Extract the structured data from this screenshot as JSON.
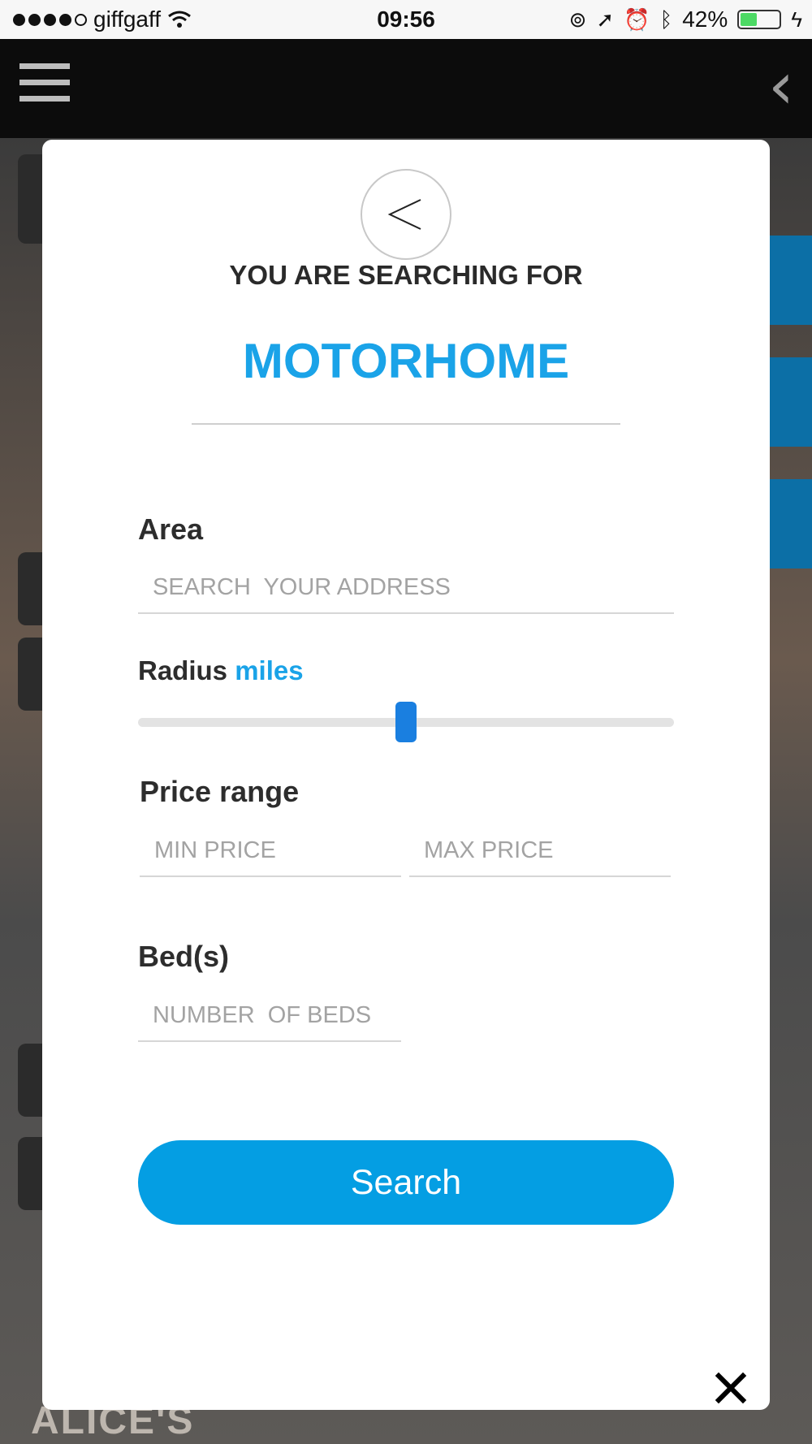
{
  "status_bar": {
    "carrier": "giffgaff",
    "time": "09:56",
    "battery": "42%",
    "battery_level": 0.42
  },
  "background": {
    "bottom_text": "ALICE'S"
  },
  "modal": {
    "heading": "YOU ARE SEARCHING FOR",
    "category": "MOTORHOME",
    "area": {
      "label": "Area",
      "placeholder": "SEARCH  YOUR ADDRESS"
    },
    "radius": {
      "label": "Radius",
      "unit": "miles",
      "value_fraction": 0.5
    },
    "price_range": {
      "label": "Price range",
      "min_placeholder": "MIN PRICE",
      "max_placeholder": "MAX PRICE"
    },
    "beds": {
      "label": "Bed(s)",
      "placeholder": "NUMBER  OF BEDS"
    },
    "search_button": "Search"
  },
  "colors": {
    "accent": "#1aa3e8",
    "button": "#049ee3",
    "slider_thumb": "#1a7fe0"
  },
  "icons": {
    "back": "chevron-left-icon",
    "menu": "hamburger-icon",
    "close": "close-icon"
  }
}
